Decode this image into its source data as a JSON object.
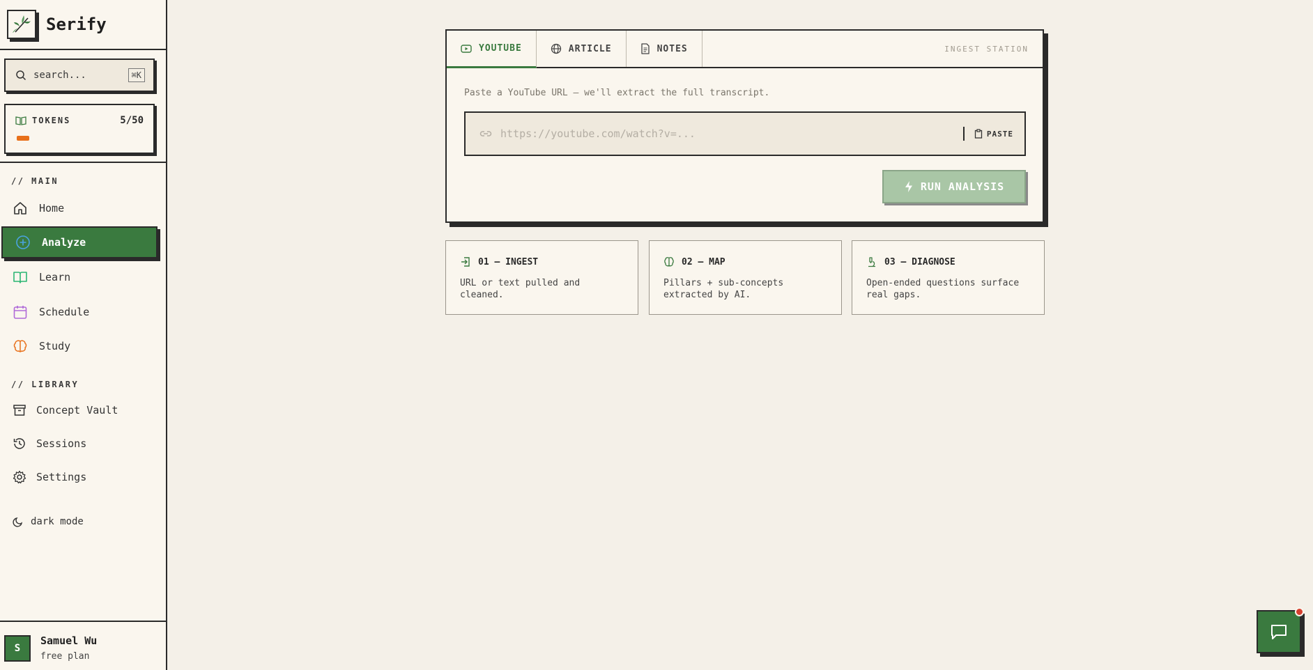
{
  "brand": {
    "name": "Serify"
  },
  "search": {
    "placeholder": "search...",
    "shortcut": "⌘K"
  },
  "tokens": {
    "label": "TOKENS",
    "count": "5/50",
    "used": 5,
    "total": 50,
    "bar_color": "#e8701a"
  },
  "nav": {
    "main_label": "// MAIN",
    "items": [
      {
        "label": "Home",
        "icon": "home-icon"
      },
      {
        "label": "Analyze",
        "icon": "plus-circle-icon",
        "active": true
      },
      {
        "label": "Learn",
        "icon": "book-open-icon"
      },
      {
        "label": "Schedule",
        "icon": "calendar-icon"
      },
      {
        "label": "Study",
        "icon": "brain-icon"
      }
    ],
    "library_label": "// LIBRARY",
    "library_items": [
      {
        "label": "Concept Vault",
        "icon": "archive-icon"
      },
      {
        "label": "Sessions",
        "icon": "history-icon"
      },
      {
        "label": "Settings",
        "icon": "gear-icon"
      }
    ],
    "dark_mode": "dark mode"
  },
  "user": {
    "initial": "S",
    "name": "Samuel Wu",
    "plan": "free plan"
  },
  "ingest": {
    "tabs": [
      {
        "label": "YOUTUBE",
        "icon": "youtube-icon",
        "active": true
      },
      {
        "label": "ARTICLE",
        "icon": "globe-icon"
      },
      {
        "label": "NOTES",
        "icon": "document-icon"
      }
    ],
    "station_label": "INGEST STATION",
    "hint": "Paste a YouTube URL — we'll extract the full transcript.",
    "url_placeholder": "https://youtube.com/watch?v=...",
    "paste_label": "PASTE",
    "run_label": "RUN ANALYSIS"
  },
  "steps": [
    {
      "title": "01 — INGEST",
      "desc": "URL or text pulled and cleaned.",
      "icon": "login-icon"
    },
    {
      "title": "02 — MAP",
      "desc": "Pillars + sub-concepts extracted by AI.",
      "icon": "brain-icon"
    },
    {
      "title": "03 — DIAGNOSE",
      "desc": "Open-ended questions surface real gaps.",
      "icon": "microscope-icon"
    }
  ],
  "colors": {
    "accent": "#3a7a3f",
    "background": "#f4f0e8",
    "ink": "#2a2a2a",
    "notification": "#d6402f"
  }
}
